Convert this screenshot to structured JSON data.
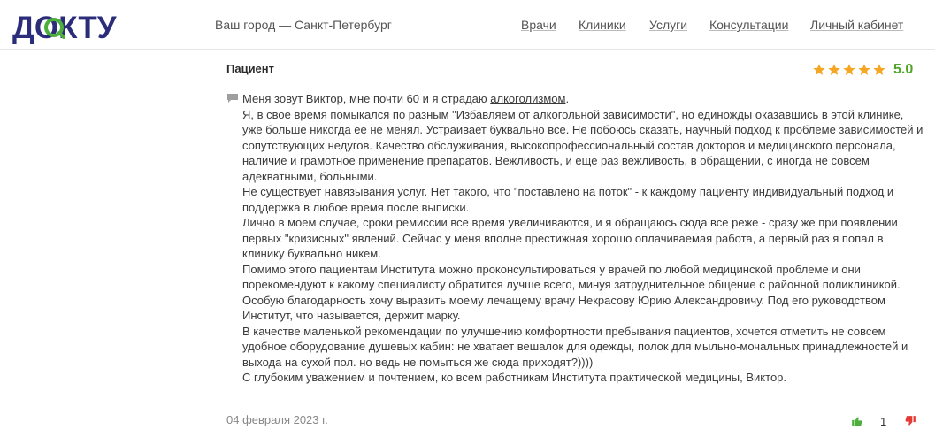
{
  "header": {
    "logo_text": "ДОКТУ",
    "city": "Ваш город — Санкт-Петербург",
    "nav": [
      "Врачи",
      "Клиники",
      "Услуги",
      "Консультации",
      "Личный кабинет"
    ]
  },
  "review": {
    "author": "Пациент",
    "rating": "5.0",
    "stars": 5,
    "intro_before_link": "Меня зовут Виктор, мне почти 60 и я страдаю ",
    "intro_link": "алкоголизмом",
    "intro_after_link": ".",
    "paragraphs": [
      "Я, в свое время помыкался по разным \"Избавляем от алкогольной зависимости\", но единожды оказавшись в этой клинике, уже больше никогда ее не менял. Устраивает буквально все. Не побоюсь сказать, научный подход к проблеме зависимостей и сопутствующих недугов. Качество обслуживания, высокопрофессиональный состав докторов и медицинского персонала, наличие и грамотное применение препаратов. Вежливость, и еще раз вежливость, в обращении, с иногда не совсем адекватными, больными.",
      "Не существует навязывания услуг. Нет такого, что \"поставлено на поток\" - к каждому пациенту индивидуальный подход и поддержка в любое время после выписки.",
      "Лично в моем случае, сроки ремиссии все время увеличиваются, и я обращаюсь сюда все реже - сразу же при появлении первых \"кризисных\" явлений. Сейчас у меня вполне престижная хорошо оплачиваемая работа, а первый раз я попал в клинику буквально никем.",
      "Помимо этого пациентам Института можно проконсультироваться у врачей по любой медицинской проблеме и они порекомендуют к какому специалисту обратится лучше всего, минуя затруднительное общение с районной поликлиникой.",
      "Особую благодарность хочу выразить моему лечащему врачу Некрасову Юрию Александровичу. Под его руководством Институт, что называется, держит марку.",
      "В качестве маленькой рекомендации по улучшению комфортности пребывания пациентов, хочется отметить не совсем удобное оборудование душевых кабин: не хватает вешалок для одежды, полок для мыльно-мочальных принадлежностей и выхода на сухой пол. но ведь не помыться же сюда приходят?))))",
      "С глубоким уважением и почтением, ко всем работникам Института практической медицины, Виктор."
    ],
    "date": "04 февраля 2023 г.",
    "likes": "1"
  },
  "colors": {
    "brand_dark": "#2b2d7a",
    "brand_green": "#4caf3c",
    "star": "#f5a623",
    "rating": "#52a428",
    "thumb_up": "#4caf3c",
    "thumb_down": "#e53935"
  },
  "icons": {
    "logo": "dokto-logo",
    "rating_star": "star-icon",
    "comment": "comment-icon",
    "like": "thumbs-up-icon",
    "dislike": "thumbs-down-icon"
  }
}
